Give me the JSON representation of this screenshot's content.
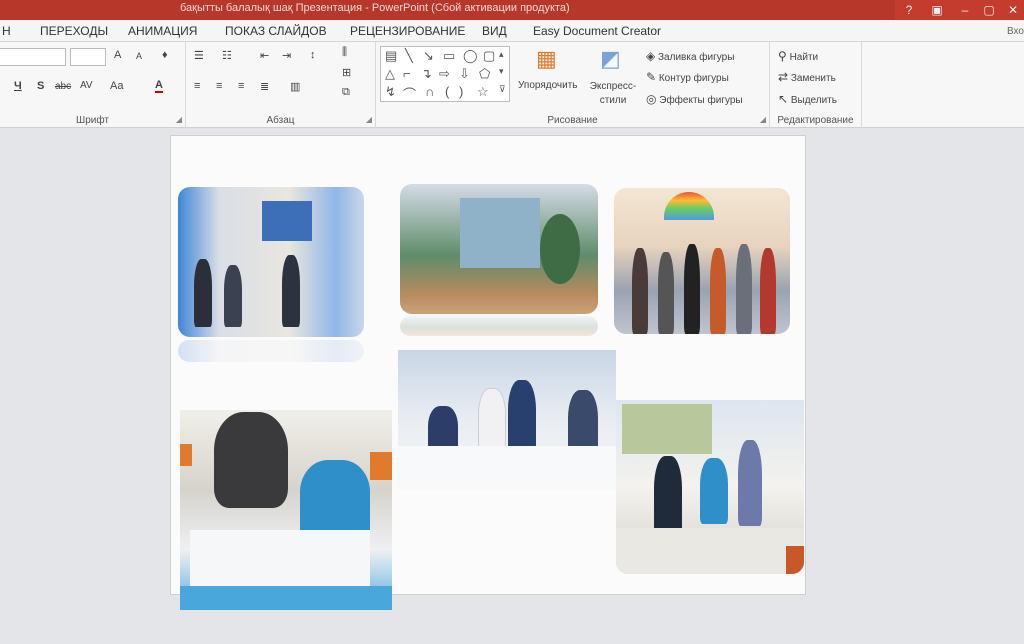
{
  "titlebar": {
    "title": "бақытты балалық шақ  Презентация -  PowerPoint (Сбой активации продукта)",
    "controls": [
      "?",
      "▣",
      "–",
      "▢",
      "✕"
    ]
  },
  "tabs": {
    "items": [
      "Н",
      "ПЕРЕХОДЫ",
      "АНИМАЦИЯ",
      "ПОКАЗ СЛАЙДОВ",
      "РЕЦЕНЗИРОВАНИЕ",
      "ВИД",
      "Easy Document Creator"
    ],
    "signin": "Вхо"
  },
  "ribbon": {
    "font_group": {
      "label": "Шрифт",
      "grow": "A",
      "shrink": "A",
      "underline": "Ч",
      "strike": "S",
      "abc": "abc",
      "spacing": "AV",
      "case": "Aa",
      "color": "A"
    },
    "paragraph_group": {
      "label": "Абзац"
    },
    "drawing_group": {
      "label": "Рисование",
      "arrange": "Упорядочить",
      "quick_styles": "Экспресс-стили",
      "fill": "Заливка фигуры",
      "outline": "Контур фигуры",
      "effects": "Эффекты фигуры"
    },
    "editing_group": {
      "label": "Редактирование",
      "find": "Найти",
      "replace": "Заменить",
      "select": "Выделить"
    }
  },
  "slide": {
    "photos": [
      "photo-1",
      "photo-2",
      "photo-3",
      "photo-4",
      "photo-5",
      "photo-6"
    ]
  }
}
